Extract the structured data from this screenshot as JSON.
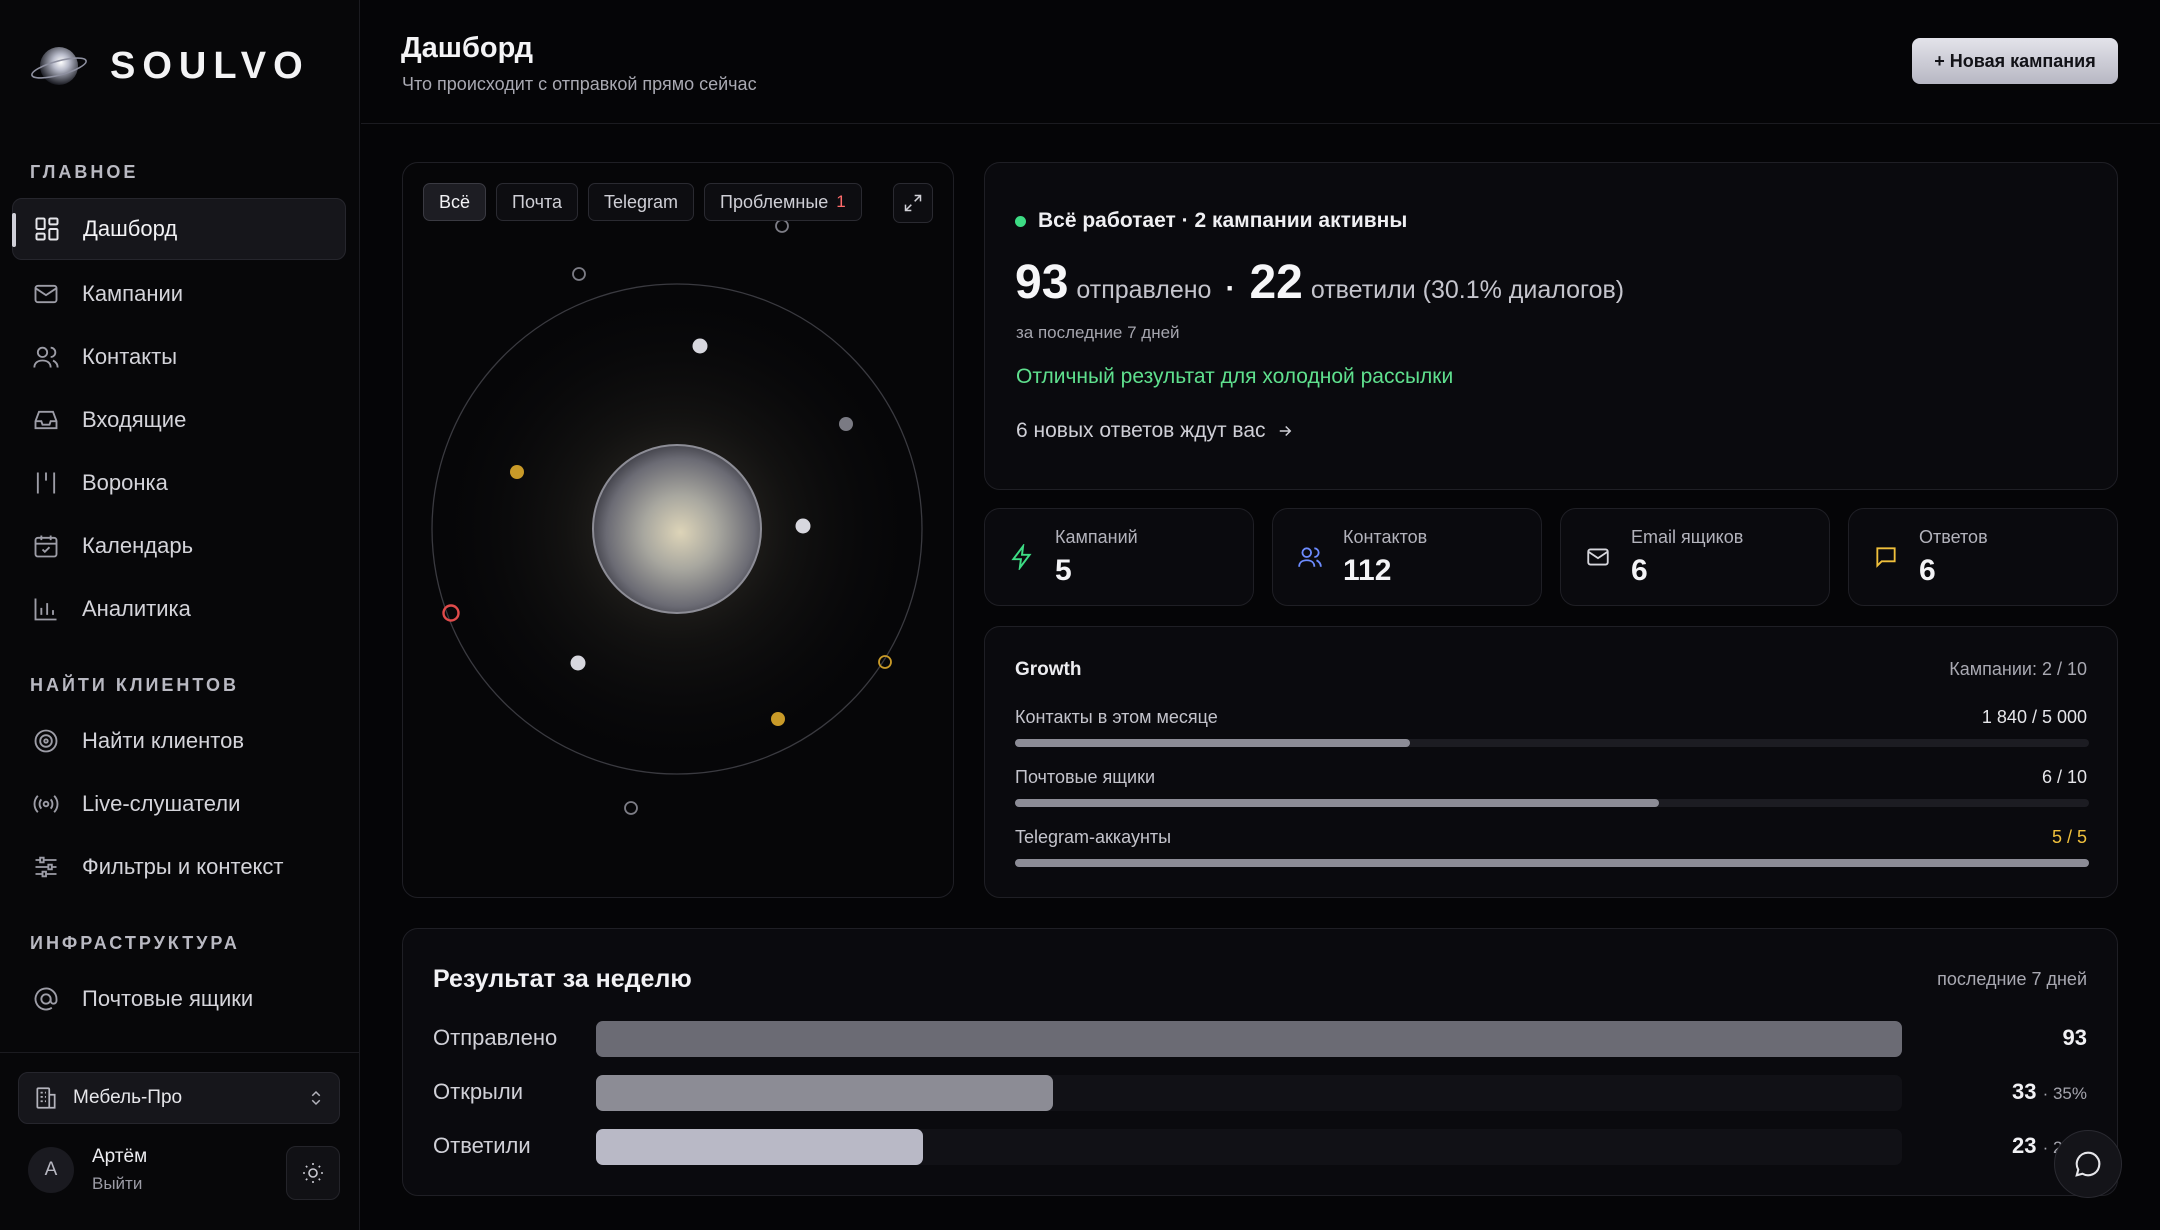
{
  "app": {
    "name": "SOULVO"
  },
  "sidebar": {
    "sections": {
      "main": "ГЛАВНОЕ",
      "find": "НАЙТИ КЛИЕНТОВ",
      "infra": "ИНФРАСТРУКТУРА"
    },
    "items": [
      {
        "label": "Дашборд",
        "icon": "dashboard-icon"
      },
      {
        "label": "Кампании",
        "icon": "mail-icon"
      },
      {
        "label": "Контакты",
        "icon": "users-icon"
      },
      {
        "label": "Входящие",
        "icon": "inbox-icon"
      },
      {
        "label": "Воронка",
        "icon": "funnel-icon"
      },
      {
        "label": "Календарь",
        "icon": "calendar-icon"
      },
      {
        "label": "Аналитика",
        "icon": "analytics-icon"
      },
      {
        "label": "Найти клиентов",
        "icon": "target-icon"
      },
      {
        "label": "Live-слушатели",
        "icon": "broadcast-icon"
      },
      {
        "label": "Фильтры и контекст",
        "icon": "sliders-icon"
      },
      {
        "label": "Почтовые ящики",
        "icon": "at-icon"
      }
    ],
    "workspace": "Мебель-Про",
    "user": {
      "initial": "А",
      "name": "Артём",
      "logout": "Выйти"
    }
  },
  "header": {
    "title": "Дашборд",
    "subtitle": "Что происходит с отправкой прямо сейчас",
    "new_campaign": "+ Новая кампания"
  },
  "orbit": {
    "filters": [
      "Всё",
      "Почта",
      "Telegram",
      "Проблемные"
    ],
    "problem_count": "1"
  },
  "status": {
    "line": "Всё работает · 2 кампании активны",
    "sent": "93",
    "sent_label": "отправлено",
    "sep": "·",
    "replied": "22",
    "replied_label": "ответили (30.1% диалогов)",
    "period": "за последние 7 дней",
    "assessment": "Отличный результат для холодной рассылки",
    "new_replies": "6 новых ответов ждут вас"
  },
  "tiles": [
    {
      "label": "Кампаний",
      "value": "5",
      "icon": "bolt-icon",
      "color": "#3ddc84"
    },
    {
      "label": "Контактов",
      "value": "112",
      "icon": "users-icon",
      "color": "#6d8cff"
    },
    {
      "label": "Email ящиков",
      "value": "6",
      "icon": "mail-icon",
      "color": "#d6d6dc"
    },
    {
      "label": "Ответов",
      "value": "6",
      "icon": "chat-icon",
      "color": "#f0c03c"
    }
  ],
  "growth": {
    "title": "Growth",
    "campaigns": "Кампании: 2 / 10",
    "rows": [
      {
        "label": "Контакты в этом месяце",
        "value": "1 840 / 5 000",
        "fraction": 0.368
      },
      {
        "label": "Почтовые ящики",
        "value": "6 / 10",
        "fraction": 0.6
      },
      {
        "label": "Telegram-аккаунты",
        "value": "5 / 5",
        "fraction": 1.0
      }
    ]
  },
  "week": {
    "title": "Результат за неделю",
    "period": "последние 7 дней",
    "rows": [
      {
        "label": "Отправлено",
        "value": "93",
        "pct": "",
        "fraction": 1.0,
        "color": "#6b6b74"
      },
      {
        "label": "Открыли",
        "value": "33",
        "pct": "· 35%",
        "fraction": 0.35,
        "color": "#8c8c95"
      },
      {
        "label": "Ответили",
        "value": "23",
        "pct": "· 25%",
        "fraction": 0.25,
        "color": "#b9b9c6"
      }
    ]
  }
}
